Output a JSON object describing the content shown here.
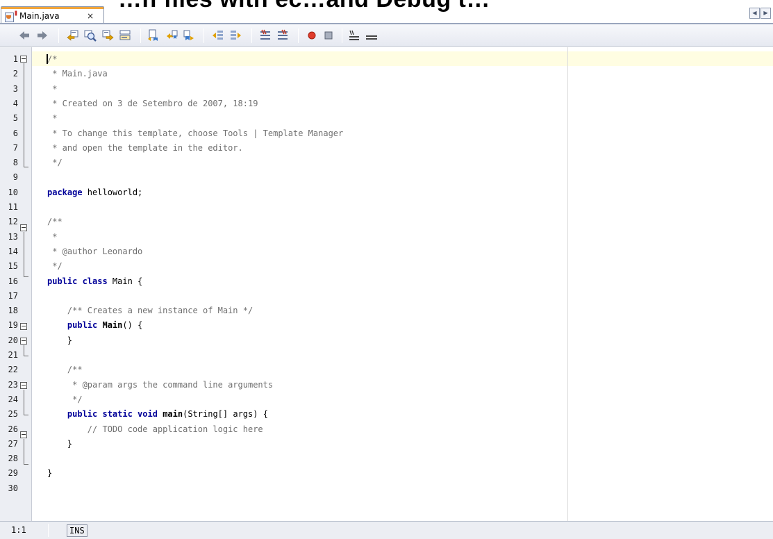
{
  "window": {
    "banner_text": "…n files with ec…and Debug t…",
    "tab_title": "Main.java",
    "tab_close": "×",
    "tab_nav_left": "◀",
    "tab_nav_right": "▶"
  },
  "toolbar": {
    "buttons": [
      {
        "name": "back",
        "icon": "back-arrow-icon"
      },
      {
        "name": "forward",
        "icon": "forward-arrow-icon"
      },
      {
        "name": "find-previous",
        "icon": "find-previous-icon"
      },
      {
        "name": "find-selection",
        "icon": "find-selection-icon"
      },
      {
        "name": "find-next",
        "icon": "find-next-icon"
      },
      {
        "name": "toggle-highlight",
        "icon": "highlight-search-icon"
      },
      {
        "name": "previous-bookmark",
        "icon": "previous-bookmark-icon"
      },
      {
        "name": "next-bookmark",
        "icon": "next-bookmark-icon"
      },
      {
        "name": "toggle-bookmark",
        "icon": "toggle-bookmark-icon"
      },
      {
        "name": "shift-left",
        "icon": "shift-left-icon"
      },
      {
        "name": "shift-right",
        "icon": "shift-right-icon"
      },
      {
        "name": "comment",
        "icon": "comment-icon"
      },
      {
        "name": "uncomment",
        "icon": "uncomment-icon"
      },
      {
        "name": "start-macro",
        "icon": "record-macro-icon"
      },
      {
        "name": "stop-macro",
        "icon": "stop-macro-icon"
      },
      {
        "name": "format",
        "icon": "format-icon"
      },
      {
        "name": "display-lines",
        "icon": "lines-icon"
      }
    ]
  },
  "editor": {
    "lines": [
      {
        "n": "1",
        "text": "/*",
        "kind": "comment"
      },
      {
        "n": "2",
        "text": " * Main.java",
        "kind": "comment"
      },
      {
        "n": "3",
        "text": " *",
        "kind": "comment"
      },
      {
        "n": "4",
        "text": " * Created on 3 de Setembro de 2007, 18:19",
        "kind": "comment"
      },
      {
        "n": "5",
        "text": " *",
        "kind": "comment"
      },
      {
        "n": "6",
        "text": " * To change this template, choose Tools | Template Manager",
        "kind": "comment"
      },
      {
        "n": "7",
        "text": " * and open the template in the editor.",
        "kind": "comment"
      },
      {
        "n": "8",
        "text": " */",
        "kind": "comment"
      },
      {
        "n": "9",
        "text": "",
        "kind": "plain"
      },
      {
        "n": "10",
        "kw": "package",
        "rest": " helloworld;",
        "kind": "kw"
      },
      {
        "n": "11",
        "text": "",
        "kind": "plain"
      },
      {
        "n": "12",
        "text": "/**",
        "kind": "comment"
      },
      {
        "n": "13",
        "text": " *",
        "kind": "comment"
      },
      {
        "n": "14",
        "text": " * @author Leonardo",
        "kind": "comment"
      },
      {
        "n": "15",
        "text": " */",
        "kind": "comment"
      },
      {
        "n": "16",
        "kw": "public class",
        "rest": " Main {",
        "kind": "kw"
      },
      {
        "n": "17",
        "text": "",
        "kind": "plain"
      },
      {
        "n": "18",
        "text": "    /** Creates a new instance of Main */",
        "kind": "comment"
      },
      {
        "n": "19",
        "pre": "    ",
        "kw": "public",
        "sp": " ",
        "name": "Main",
        "rest": "() {",
        "kind": "kwname"
      },
      {
        "n": "20",
        "text": "    }",
        "kind": "plain"
      },
      {
        "n": "21",
        "text": "",
        "kind": "plain"
      },
      {
        "n": "22",
        "text": "    /**",
        "kind": "comment"
      },
      {
        "n": "23",
        "text": "     * @param args the command line arguments",
        "kind": "comment"
      },
      {
        "n": "24",
        "text": "     */",
        "kind": "comment"
      },
      {
        "n": "25",
        "pre": "    ",
        "kw": "public static void",
        "sp": " ",
        "name": "main",
        "rest": "(String[] args) {",
        "kind": "kwname"
      },
      {
        "n": "26",
        "text": "        // TODO code application logic here",
        "kind": "comment"
      },
      {
        "n": "27",
        "text": "    }",
        "kind": "plain"
      },
      {
        "n": "28",
        "text": "",
        "kind": "plain"
      },
      {
        "n": "29",
        "text": "}",
        "kind": "plain"
      },
      {
        "n": "30",
        "text": "",
        "kind": "plain"
      }
    ]
  },
  "status": {
    "position": "1:1",
    "mode": "INS"
  }
}
